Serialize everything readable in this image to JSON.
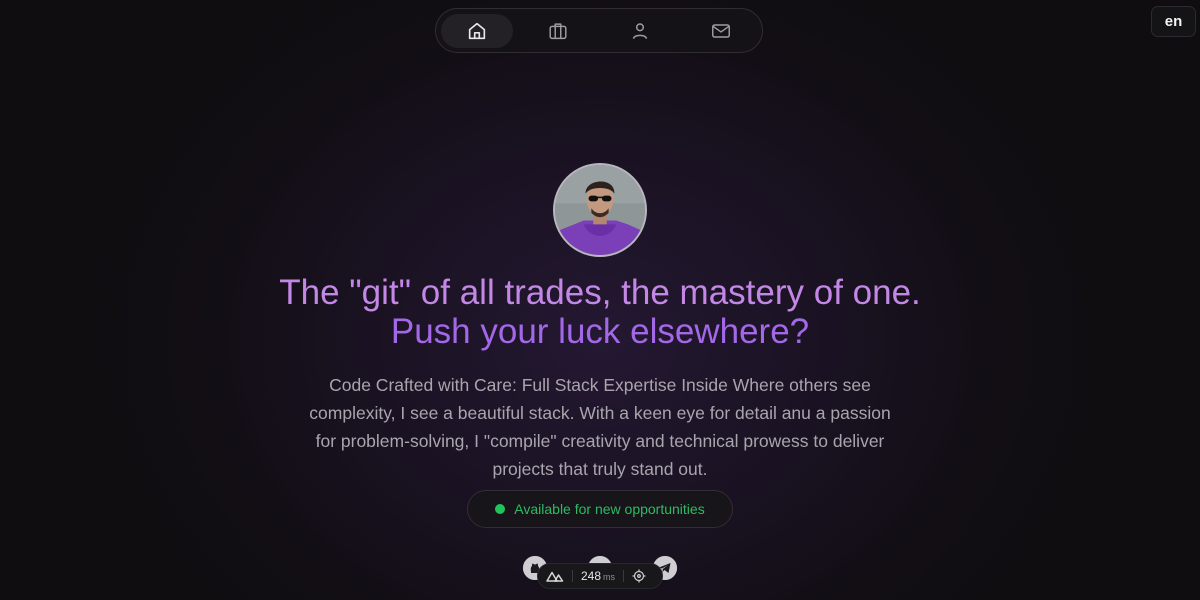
{
  "nav": {
    "items": [
      {
        "icon": "home-icon",
        "active": true
      },
      {
        "icon": "briefcase-icon",
        "active": false
      },
      {
        "icon": "user-icon",
        "active": false
      },
      {
        "icon": "mail-icon",
        "active": false
      }
    ]
  },
  "language": "en",
  "hero": {
    "headline_line1": "The \"git\" of all trades, the mastery of one.",
    "headline_line2": "Push your luck elsewhere?",
    "description": "Code Crafted with Care: Full Stack Expertise Inside Where others see complexity, I see a beautiful stack. With a keen eye for detail anu a passion for problem-solving, I \"compile\" creativity and technical prowess to deliver projects that truly stand out.",
    "status": "Available for new opportunities"
  },
  "colors": {
    "headline_1": "#c387e6",
    "headline_2": "#a268e8",
    "status_green": "#21c35a"
  },
  "social": [
    "github-icon",
    "circle-icon",
    "telegram-icon"
  ],
  "devtools": {
    "time_value": "248",
    "time_unit": "ms"
  }
}
